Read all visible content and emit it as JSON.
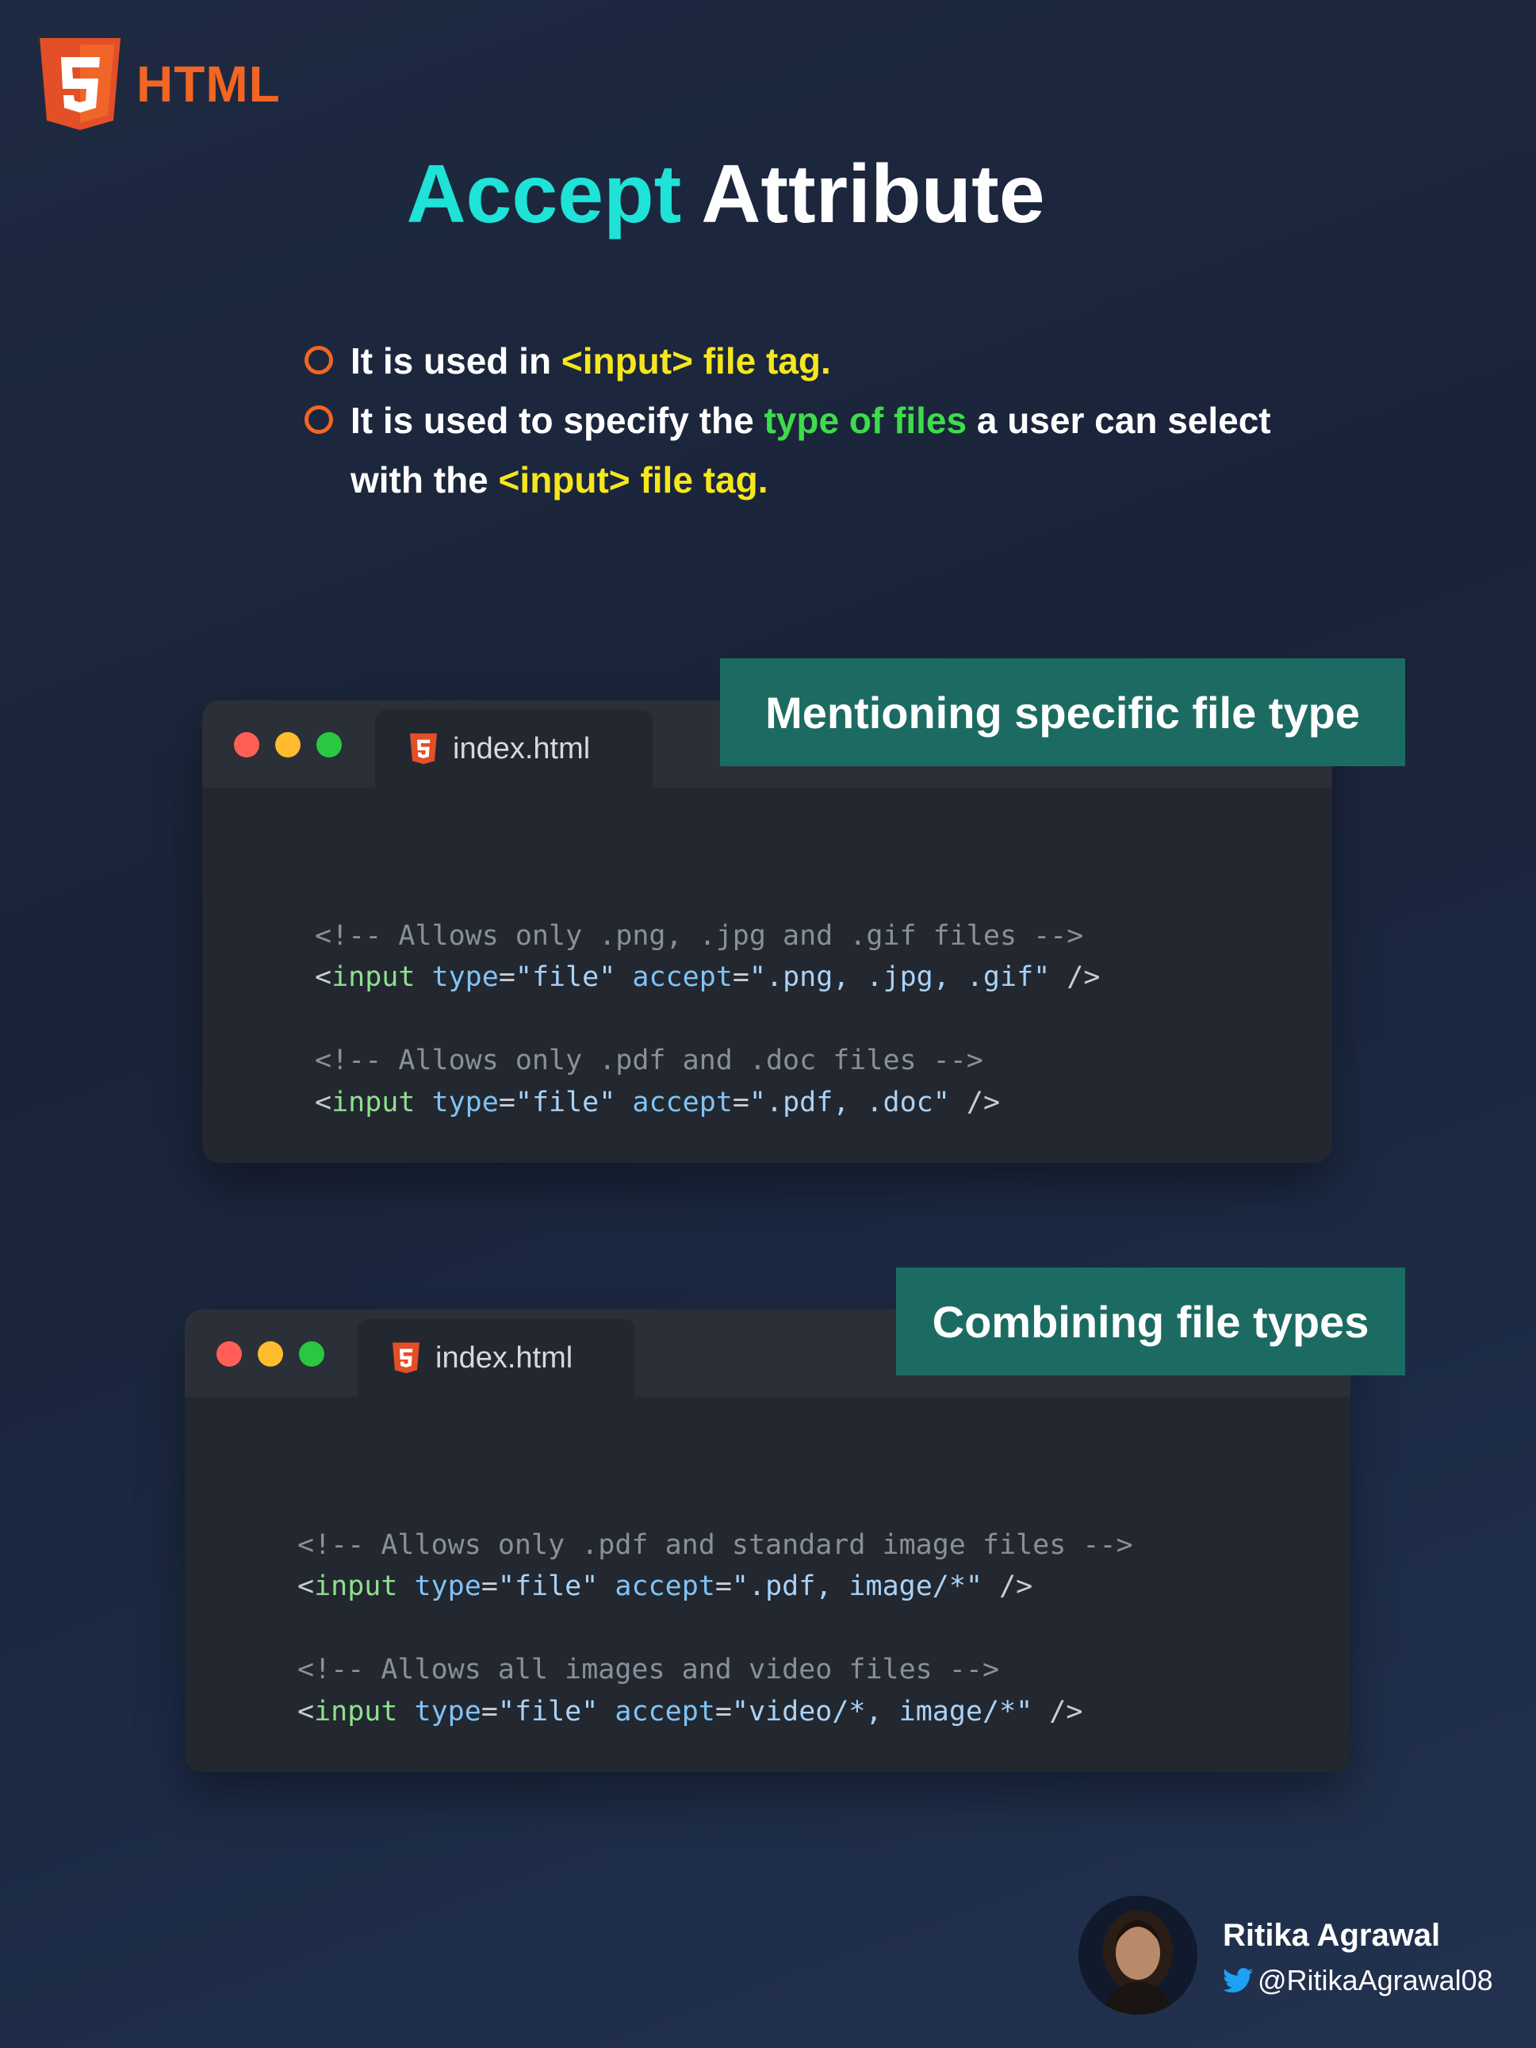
{
  "brand": {
    "logo_text": "HTML",
    "logo_color": "#f26522"
  },
  "title": {
    "part1": "Accept",
    "part2": "Attribute",
    "accent": "#1ee3d6"
  },
  "bullets": [
    {
      "t1": "It is used in ",
      "hl1": "<input> file tag."
    },
    {
      "t1": "It is used to specify the ",
      "hl1": "type of files",
      "t2": " a user can select with the ",
      "hl2": "<input> file tag."
    }
  ],
  "sections": [
    {
      "badge": "Mentioning specific file type",
      "tab": "index.html",
      "lines": [
        {
          "comment": "<!-- Allows only .png, .jpg and .gif files -->"
        },
        {
          "tag": "input",
          "type_attr": "type",
          "type_val": "\"file\"",
          "accept_attr": "accept",
          "accept_val": "\".png, .jpg, .gif\""
        },
        {
          "comment": "<!-- Allows only .pdf and .doc files -->"
        },
        {
          "tag": "input",
          "type_attr": "type",
          "type_val": "\"file\"",
          "accept_attr": "accept",
          "accept_val": "\".pdf, .doc\""
        }
      ]
    },
    {
      "badge": "Combining file types",
      "tab": "index.html",
      "lines": [
        {
          "comment": "<!-- Allows only .pdf and standard image files -->"
        },
        {
          "tag": "input",
          "type_attr": "type",
          "type_val": "\"file\"",
          "accept_attr": "accept",
          "accept_val": "\".pdf, image/*\""
        },
        {
          "comment": "<!-- Allows all images and video files -->"
        },
        {
          "tag": "input",
          "type_attr": "type",
          "type_val": "\"file\"",
          "accept_attr": "accept",
          "accept_val": "\"video/*, image/*\""
        }
      ]
    }
  ],
  "author": {
    "name": "Ritika Agrawal",
    "handle": "@RitikaAgrawal08",
    "icon": "twitter-bird-icon"
  }
}
